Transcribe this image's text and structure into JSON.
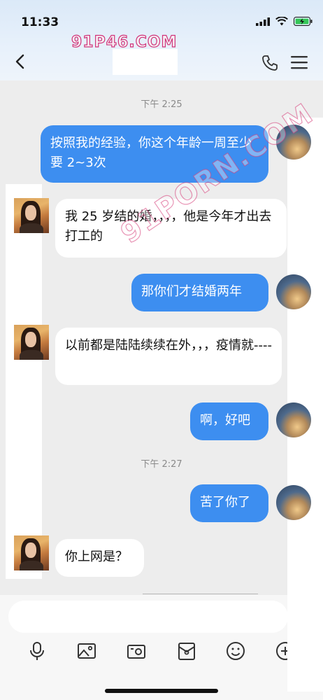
{
  "status": {
    "time": "11:33"
  },
  "header": {
    "watermark": "91P46.COM",
    "title": ""
  },
  "watermark_diag": "91PORN.COM",
  "chat": {
    "timestamps": [
      "下午 2:25",
      "下午 2:27"
    ],
    "messages": [
      {
        "side": "out",
        "text": "按照我的经验，你这个年龄一周至少要 2~3次"
      },
      {
        "side": "in",
        "text": "我 25 岁结的婚，，，，他是今年才出去打工的"
      },
      {
        "side": "out",
        "text": "那你们才结婚两年"
      },
      {
        "side": "in",
        "text": "以前都是陆陆续续在外，，，疫情就----"
      },
      {
        "side": "out",
        "text": "啊，好吧"
      },
      {
        "side": "out",
        "text": "苦了你了"
      },
      {
        "side": "in",
        "text": "你上网是？"
      }
    ]
  },
  "input": {
    "placeholder": ""
  },
  "icons": {
    "back": "chevron-left-icon",
    "call": "phone-icon",
    "menu": "menu-icon",
    "mic": "microphone-icon",
    "image": "image-icon",
    "camera": "camera-icon",
    "gift": "red-packet-icon",
    "emoji": "emoji-icon",
    "plus": "plus-icon"
  },
  "colors": {
    "bubble_out": "#3d8ef0",
    "bubble_in": "#ffffff",
    "watermark": "#d0347a"
  }
}
